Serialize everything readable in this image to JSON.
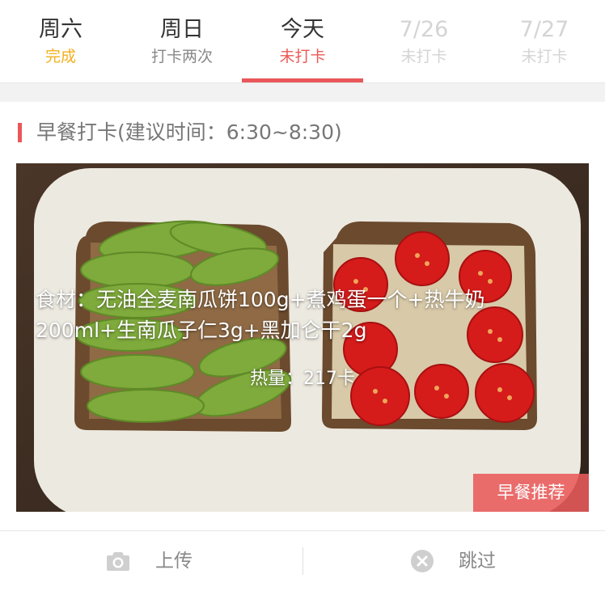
{
  "tabs": [
    {
      "day": "周六",
      "status": "完成",
      "state": "done"
    },
    {
      "day": "周日",
      "status": "打卡两次",
      "state": "normal"
    },
    {
      "day": "今天",
      "status": "未打卡",
      "state": "active"
    },
    {
      "day": "7/26",
      "status": "未打卡",
      "state": "disabled"
    },
    {
      "day": "7/27",
      "status": "未打卡",
      "state": "disabled"
    }
  ],
  "section": {
    "title": "早餐打卡(建议时间：6:30~8:30)"
  },
  "meal": {
    "ingredients": "食材：无油全麦南瓜饼100g+煮鸡蛋一个+热牛奶200ml+生南瓜子仁3g+黑加仑干2g",
    "calories": "热量：217卡",
    "recommend_label": "早餐推荐"
  },
  "actions": {
    "upload_label": "上传",
    "skip_label": "跳过"
  },
  "colors": {
    "accent": "#e9575a",
    "done": "#f2b01e"
  },
  "icons": {
    "upload": "camera-icon",
    "skip": "close-circle-icon"
  }
}
